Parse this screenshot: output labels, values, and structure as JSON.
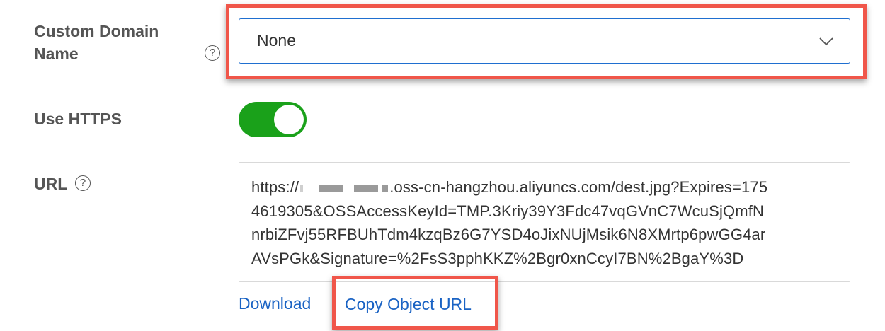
{
  "form": {
    "custom_domain": {
      "label_line1": "Custom Domain",
      "label_line2": "Name",
      "help_icon": "question-circle-icon",
      "help_glyph": "?",
      "selected_value": "None",
      "dropdown_icon": "chevron-down-icon"
    },
    "use_https": {
      "label": "Use HTTPS",
      "enabled": true,
      "on_color": "#1aa11a"
    },
    "url": {
      "label": "URL",
      "help_icon": "question-circle-icon",
      "help_glyph": "?",
      "line1_prefix": "https://",
      "line1_suffix": ".oss-cn-hangzhou.aliyuncs.com/dest.jpg?Expires=175",
      "line2": "4619305&OSSAccessKeyId=TMP.3Kriy39Y3Fdc47vqGVnC7WcuSjQmfN",
      "line3": "nrbiZFvj55RFBUhTdm4kzqBz6G7YSD4oJixNUjMsik6N8XMrtp6pwGG4ar",
      "line4": "AVsPGk&Signature=%2FsS3pphKKZ%2Bgr0xnCcyI7BN%2BgaY%3D"
    }
  },
  "actions": {
    "download_label": "Download",
    "copy_url_label": "Copy Object URL"
  },
  "colors": {
    "link": "#1a63c4",
    "focus_border": "#1f6fd0",
    "highlight": "#f0564a"
  }
}
